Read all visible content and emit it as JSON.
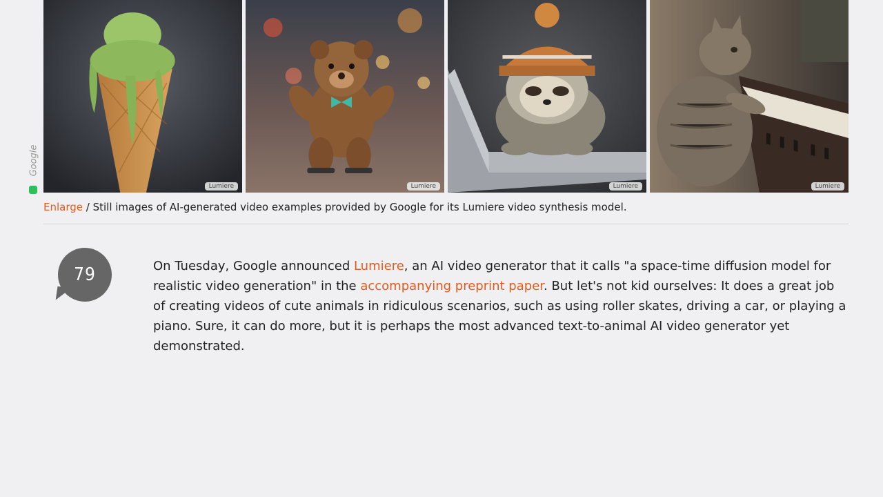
{
  "gallery": {
    "tiles": [
      {
        "subject": "ice-cream-cone",
        "watermark": "Lumiere"
      },
      {
        "subject": "teddy-bear-roller-skates",
        "watermark": "Lumiere"
      },
      {
        "subject": "sloth-laptop",
        "watermark": "Lumiere"
      },
      {
        "subject": "cat-piano",
        "watermark": "Lumiere"
      }
    ],
    "credit": "Google"
  },
  "caption": {
    "enlarge_label": "Enlarge",
    "text": " / Still images of AI-generated video examples provided by Google for its Lumiere video synthesis model."
  },
  "comments": {
    "count": "79"
  },
  "article": {
    "part1": "On Tuesday, Google announced ",
    "link1": "Lumiere",
    "part2": ", an AI video generator that it calls \"a space-time diffusion model for realistic video generation\" in the ",
    "link2": "accompanying preprint paper",
    "part3": ". But let's not kid ourselves: It does a great job of creating videos of cute animals in ridiculous scenarios, such as using roller skates, driving a car, or playing a piano. Sure, it can do more, but it is perhaps the most advanced text-to-animal AI video generator yet demonstrated."
  },
  "colors": {
    "link": "#e25a1c",
    "bubble": "#666666",
    "background": "#f0f0f2"
  }
}
